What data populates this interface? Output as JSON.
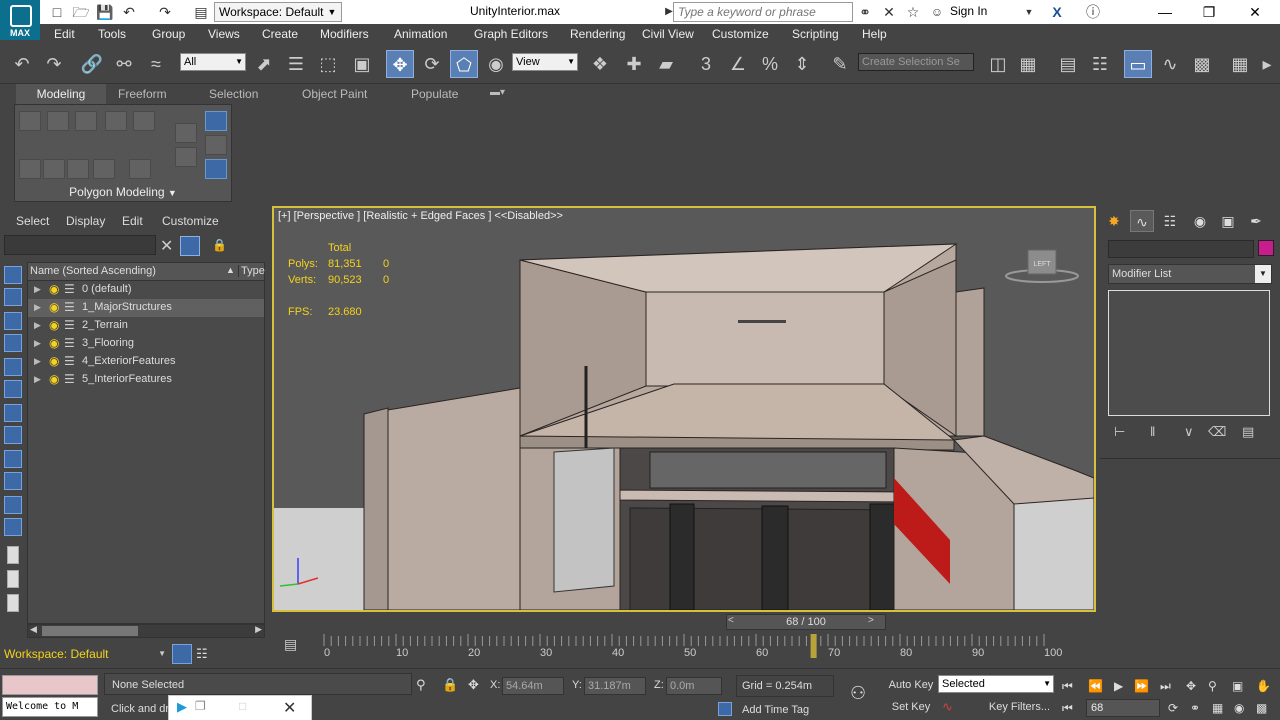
{
  "titlebar": {
    "logo_text": "MAX",
    "workspace": "Workspace: Default",
    "title": "UnityInterior.max",
    "search_placeholder": "Type a keyword or phrase",
    "signin": "Sign In"
  },
  "menu": [
    "Edit",
    "Tools",
    "Group",
    "Views",
    "Create",
    "Modifiers",
    "Animation",
    "Graph Editors",
    "Rendering",
    "Civil View",
    "Customize",
    "Scripting",
    "Help"
  ],
  "toolbar": {
    "filter": "All",
    "ref_coord": "View",
    "selection_set_placeholder": "Create Selection Se"
  },
  "ribbon": {
    "tabs": [
      "Modeling",
      "Freeform",
      "Selection",
      "Object Paint",
      "Populate"
    ],
    "panel_label": "Polygon Modeling"
  },
  "scene_explorer": {
    "menu": [
      "Select",
      "Display",
      "Edit",
      "Customize"
    ],
    "col_name": "Name (Sorted Ascending)",
    "col_type": "Type",
    "layers": [
      {
        "label": "0 (default)"
      },
      {
        "label": "1_MajorStructures"
      },
      {
        "label": "2_Terrain"
      },
      {
        "label": "3_Flooring"
      },
      {
        "label": "4_ExteriorFeatures"
      },
      {
        "label": "5_InteriorFeatures"
      }
    ],
    "workspace": "Workspace: Default"
  },
  "viewport": {
    "label": "[+] [Perspective ] [Realistic + Edged Faces ]  <<Disabled>>",
    "stats": {
      "total_label": "Total",
      "polys_label": "Polys:",
      "polys_total": "81,351",
      "polys_sel": "0",
      "verts_label": "Verts:",
      "verts_total": "90,523",
      "verts_sel": "0",
      "fps_label": "FPS:",
      "fps": "23.680"
    },
    "viewcube_label": "LEFT"
  },
  "command_panel": {
    "modifier_list": "Modifier List",
    "object_color": "#c81d8e"
  },
  "timeline": {
    "current_frame": 68,
    "total_frames": 100,
    "slider_text": "68 / 100",
    "ticks": [
      0,
      10,
      20,
      30,
      40,
      50,
      60,
      70,
      80,
      90,
      100
    ]
  },
  "status": {
    "selection": "None Selected",
    "prompt": "Click and dr",
    "maxscript": "Welcome to M",
    "x_label": "X:",
    "x": "54.64m",
    "y_label": "Y:",
    "y": "31.187m",
    "z_label": "Z:",
    "z": "0.0m",
    "grid": "Grid = 0.254m",
    "add_time_tag": "Add Time Tag",
    "auto_key": "Auto Key",
    "set_key": "Set Key",
    "key_mode": "Selected",
    "key_filters": "Key Filters...",
    "frame": "68"
  },
  "colors": {
    "accent_blue": "#3d6aa6",
    "viewport_border": "#d6c23a",
    "stats_yellow": "#f5d21b"
  }
}
